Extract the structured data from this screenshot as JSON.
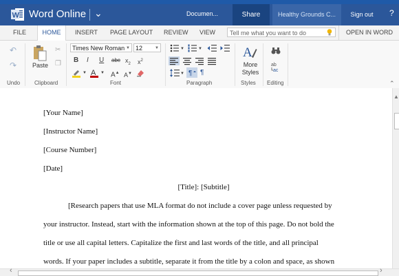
{
  "titlebar": {
    "app_name": "Word Online",
    "doc_name": "Documen...",
    "share": "Share",
    "tenant": "Healthy Grounds C...",
    "signout": "Sign out",
    "help": "?"
  },
  "tabs": [
    {
      "label": "FILE"
    },
    {
      "label": "HOME"
    },
    {
      "label": "INSERT"
    },
    {
      "label": "PAGE LAYOUT"
    },
    {
      "label": "REVIEW"
    },
    {
      "label": "VIEW"
    }
  ],
  "tellme_placeholder": "Tell me what you want to do",
  "open_in_word": "OPEN IN WORD",
  "ribbon": {
    "groups": {
      "undo": "Undo",
      "clipboard": "Clipboard",
      "font": "Font",
      "paragraph": "Paragraph",
      "styles": "Styles",
      "editing": "Editing"
    },
    "paste": "Paste",
    "font_name": "Times New Roman",
    "font_size": "12",
    "bold": "B",
    "italic": "I",
    "underline": "U",
    "strike": "abc",
    "subscript": "x",
    "superscript": "x",
    "grow": "A",
    "shrink": "A",
    "styles_label": "More Styles",
    "colors": {
      "accent": "#2b579a",
      "highlight": "#f2d21b",
      "fontcolor": "#c00000",
      "clear": "#e06666"
    }
  },
  "document": {
    "lines": [
      "[Your Name]",
      "[Instructor Name]",
      "[Course Number]",
      "[Date]"
    ],
    "title": "[Title]: [Subtitle]",
    "para": [
      "[Research papers that use MLA format do not include a cover page unless requested by",
      "your instructor. Instead, start with the information shown at the top of this page.  Do not bold the",
      "title or use all capital letters. Capitalize the first and last words of the title, and all principal",
      "words. If your paper includes a subtitle, separate it from the title by a colon and space, as shown"
    ]
  }
}
